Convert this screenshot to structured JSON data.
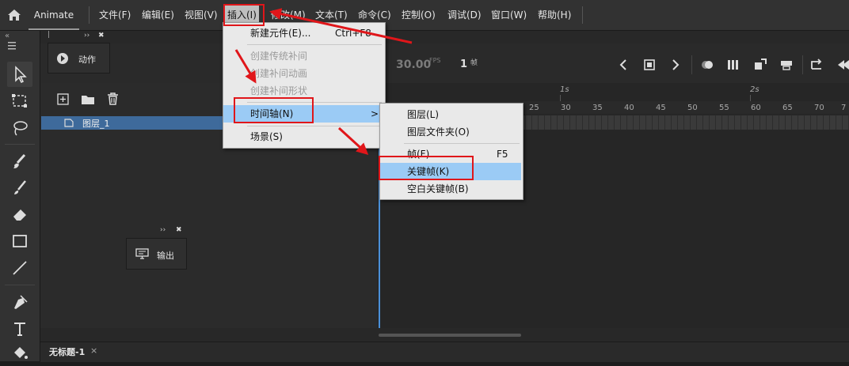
{
  "app": {
    "name": "Animate"
  },
  "menubar": {
    "items": [
      "文件(F)",
      "编辑(E)",
      "视图(V)",
      "插入(I)",
      "修改(M)",
      "文本(T)",
      "命令(C)",
      "控制(O)",
      "调试(D)",
      "窗口(W)",
      "帮助(H)"
    ],
    "active_index": 3
  },
  "insert_menu": {
    "new_symbol": {
      "label": "新建元件(E)...",
      "shortcut": "Ctrl+F8"
    },
    "disabled_items": [
      "创建传统补间",
      "创建补间动画",
      "创建补间形状"
    ],
    "timeline": {
      "label": "时间轴(N)",
      "arrow": ">"
    },
    "scene": "场景(S)"
  },
  "timeline_submenu": {
    "layer": "图层(L)",
    "layer_folder": "图层文件夹(O)",
    "frame": {
      "label": "帧(F)",
      "shortcut": "F5"
    },
    "keyframe": "关键帧(K)",
    "blank_keyframe": "空白关键帧(B)"
  },
  "panels": {
    "actions": "动作",
    "output": "输出"
  },
  "timeline": {
    "fps_value": "30.00",
    "fps_unit": "FPS",
    "frame_value": "1",
    "frame_unit": "帧",
    "layer_name": "图层_1",
    "second_markers": [
      "1s",
      "2s"
    ],
    "ruler_ticks": [
      "25",
      "30",
      "35",
      "40",
      "45",
      "50",
      "55",
      "60",
      "65",
      "70",
      "7"
    ]
  },
  "document_tab": {
    "title": "无标题-1",
    "close": "×"
  },
  "colors": {
    "highlight": "#9bcbf5",
    "annotation_red": "#e0161a",
    "layer_selected": "#3e6a9b"
  }
}
